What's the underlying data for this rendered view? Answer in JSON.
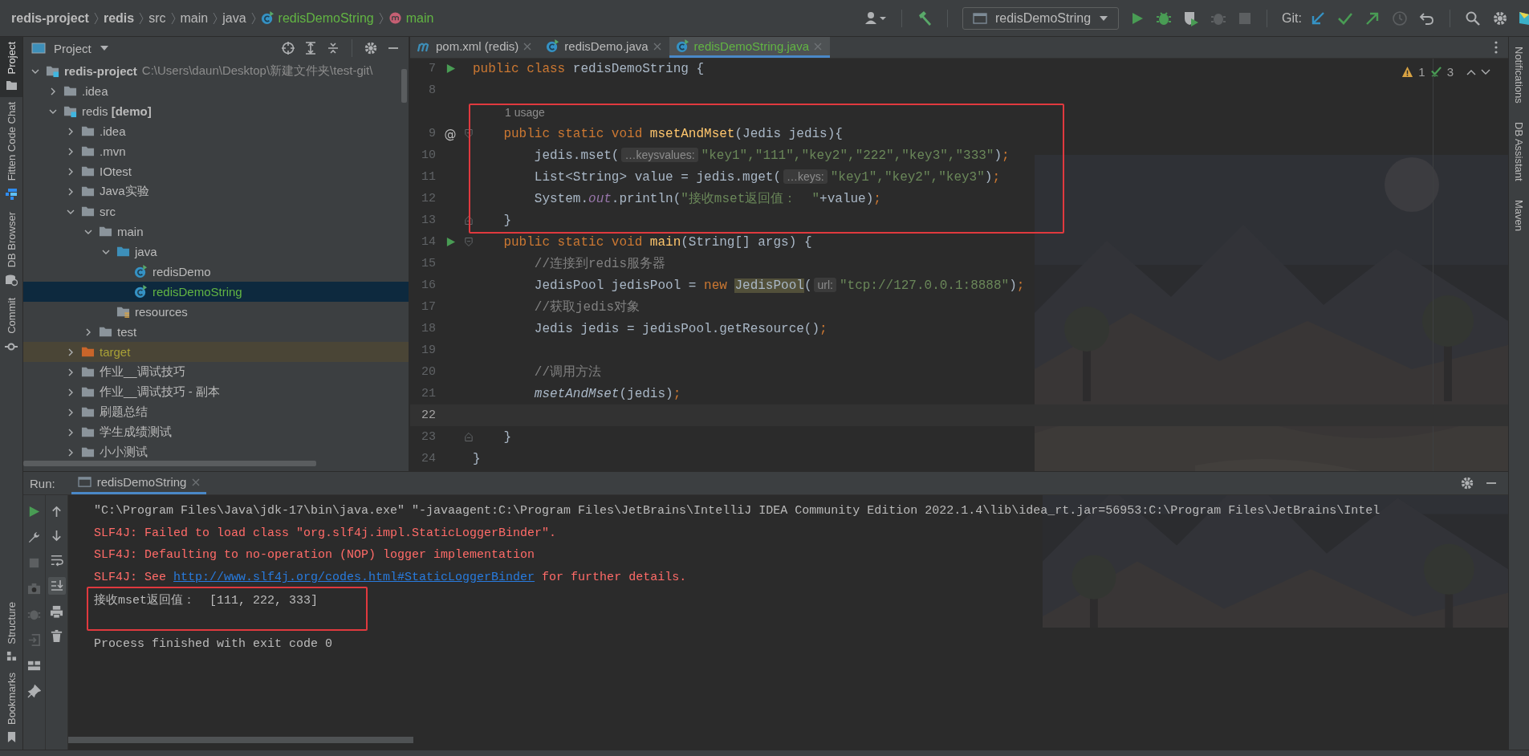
{
  "breadcrumbs": [
    {
      "text": "redis-project",
      "kind": "project",
      "added": false
    },
    {
      "text": "redis",
      "kind": "module",
      "added": false
    },
    {
      "text": "src",
      "kind": "folder",
      "added": false
    },
    {
      "text": "main",
      "kind": "folder",
      "added": false
    },
    {
      "text": "java",
      "kind": "folder",
      "added": false
    },
    {
      "text": "redisDemoString",
      "kind": "class",
      "added": true
    },
    {
      "text": "main",
      "kind": "method",
      "added": true
    }
  ],
  "toolbar": {
    "run_config": "redisDemoString",
    "git_label": "Git:"
  },
  "left_stripe": [
    {
      "label": "Project",
      "kind": "project",
      "selected": true
    },
    {
      "label": "Fitten Code Chat",
      "kind": "chat",
      "selected": false
    },
    {
      "label": "DB Browser",
      "kind": "db",
      "selected": false
    },
    {
      "label": "Commit",
      "kind": "commit",
      "selected": false
    }
  ],
  "left_stripe_bottom": [
    {
      "label": "Structure",
      "kind": "structure"
    },
    {
      "label": "Bookmarks",
      "kind": "bookmark"
    }
  ],
  "right_stripe": [
    {
      "label": "Notifications"
    },
    {
      "label": "DB Assistant"
    },
    {
      "label": "Maven"
    }
  ],
  "project": {
    "title": "Project",
    "tree": [
      {
        "label": "redis-project",
        "path": "C:\\Users\\daun\\Desktop\\新建文件夹\\test-git\\",
        "kind": "module",
        "expanded": true,
        "selected": false,
        "children": [
          {
            "label": ".idea",
            "kind": "folder",
            "expanded": false,
            "selected": false
          },
          {
            "label": "redis **[demo]**",
            "kind": "module",
            "expanded": true,
            "selected": false,
            "children": [
              {
                "label": ".idea",
                "kind": "folder",
                "expanded": false,
                "selected": false
              },
              {
                "label": ".mvn",
                "kind": "folder",
                "expanded": false,
                "selected": false
              },
              {
                "label": "IOtest",
                "kind": "folder",
                "expanded": false,
                "selected": false
              },
              {
                "label": "Java实验",
                "kind": "folder",
                "expanded": false,
                "selected": false
              },
              {
                "label": "src",
                "kind": "folder",
                "expanded": true,
                "selected": false,
                "children": [
                  {
                    "label": "main",
                    "kind": "folder",
                    "expanded": true,
                    "selected": false,
                    "children": [
                      {
                        "label": "java",
                        "kind": "source",
                        "expanded": true,
                        "selected": false,
                        "children": [
                          {
                            "label": "redisDemo",
                            "kind": "class",
                            "added": false,
                            "selected": false
                          },
                          {
                            "label": "redisDemoString",
                            "kind": "class",
                            "added": true,
                            "selected": true
                          }
                        ]
                      },
                      {
                        "label": "resources",
                        "kind": "resources",
                        "selected": false
                      }
                    ]
                  },
                  {
                    "label": "test",
                    "kind": "folder",
                    "expanded": false,
                    "selected": false
                  }
                ]
              },
              {
                "label": "target",
                "kind": "excluded",
                "expanded": false,
                "selected": false
              },
              {
                "label": "作业__调试技巧",
                "kind": "folder",
                "expanded": false,
                "selected": false
              },
              {
                "label": "作业__调试技巧 - 副本",
                "kind": "folder",
                "expanded": false,
                "selected": false
              },
              {
                "label": "刷题总结",
                "kind": "folder",
                "expanded": false,
                "selected": false
              },
              {
                "label": "学生成绩测试",
                "kind": "folder",
                "expanded": false,
                "selected": false
              },
              {
                "label": "小小测试",
                "kind": "folder",
                "expanded": false,
                "selected": false
              }
            ]
          }
        ]
      }
    ]
  },
  "editor": {
    "tabs": [
      {
        "label": "pom.xml (redis)",
        "kind": "maven",
        "added": false,
        "selected": false
      },
      {
        "label": "redisDemo.java",
        "kind": "class",
        "added": false,
        "selected": false
      },
      {
        "label": "redisDemoString.java",
        "kind": "class",
        "added": true,
        "selected": true
      }
    ],
    "warnings": "1",
    "weak_warnings": "3",
    "blocks": [
      {
        "boxed": false,
        "lines": [
          {
            "number": "7",
            "gutter": {
              "kind": "run"
            },
            "current": false,
            "tokens": [
              {
                "t": "public class ",
                "kind": "kw"
              },
              {
                "t": "redisDemoString {",
                "kind": "plain"
              }
            ]
          },
          {
            "number": "8",
            "current": false
          }
        ]
      },
      {
        "boxed": true,
        "lines": [
          {
            "kind": "usage",
            "text": "1 usage"
          },
          {
            "number": "9",
            "gutter_text": "@",
            "fold": {
              "kind": "start"
            },
            "current": false,
            "tokens": [
              {
                "t": "    public static void ",
                "kind": "kw"
              },
              {
                "t": "msetAndMset",
                "kind": "fn"
              },
              {
                "t": "(Jedis jedis){",
                "kind": "plain"
              }
            ]
          },
          {
            "number": "10",
            "current": false,
            "tokens": [
              {
                "t": "        jedis.mset(",
                "kind": "plain"
              },
              {
                "t": "…keysvalues:",
                "kind": "hint"
              },
              {
                "t": "\"key1\",\"111\",\"key2\",\"222\",\"key3\",\"333\"",
                "kind": "str"
              },
              {
                "t": ")",
                "kind": "plain"
              },
              {
                "t": ";",
                "kind": "semi"
              }
            ]
          },
          {
            "number": "11",
            "current": false,
            "tokens": [
              {
                "t": "        List<String> value = jedis.mget(",
                "kind": "plain"
              },
              {
                "t": "…keys:",
                "kind": "hint"
              },
              {
                "t": "\"key1\",\"key2\",\"key3\"",
                "kind": "str"
              },
              {
                "t": ")",
                "kind": "plain"
              },
              {
                "t": ";",
                "kind": "semi"
              }
            ]
          },
          {
            "number": "12",
            "current": false,
            "tokens": [
              {
                "t": "        System.",
                "kind": "plain"
              },
              {
                "t": "out",
                "kind": "field"
              },
              {
                "t": ".println(",
                "kind": "plain"
              },
              {
                "t": "\"接收mset返回值：  \"",
                "kind": "str"
              },
              {
                "t": "+value)",
                "kind": "plain"
              },
              {
                "t": ";",
                "kind": "semi"
              }
            ]
          },
          {
            "number": "13",
            "fold": {
              "kind": "end"
            },
            "current": false,
            "tokens": [
              {
                "t": "    }",
                "kind": "plain"
              }
            ]
          }
        ]
      },
      {
        "boxed": false,
        "lines": [
          {
            "number": "14",
            "gutter": {
              "kind": "run"
            },
            "fold": {
              "kind": "start"
            },
            "current": false,
            "tokens": [
              {
                "t": "    public static void ",
                "kind": "kw"
              },
              {
                "t": "main",
                "kind": "fn"
              },
              {
                "t": "(String[] args) {",
                "kind": "plain"
              }
            ]
          },
          {
            "number": "15",
            "current": false,
            "tokens": [
              {
                "t": "        //连接到redis服务器",
                "kind": "cmt"
              }
            ]
          },
          {
            "number": "16",
            "current": false,
            "tokens": [
              {
                "t": "        JedisPool jedisPool = ",
                "kind": "plain"
              },
              {
                "t": "new ",
                "kind": "kw"
              },
              {
                "t": "JedisPool",
                "kind": "mark"
              },
              {
                "t": "(",
                "kind": "plain"
              },
              {
                "t": "url:",
                "kind": "hint"
              },
              {
                "t": "\"tcp://127.0.0.1:8888\"",
                "kind": "str"
              },
              {
                "t": ")",
                "kind": "plain"
              },
              {
                "t": ";",
                "kind": "semi"
              }
            ]
          },
          {
            "number": "17",
            "current": false,
            "tokens": [
              {
                "t": "        //获取jedis对象",
                "kind": "cmt"
              }
            ]
          },
          {
            "number": "18",
            "current": false,
            "tokens": [
              {
                "t": "        Jedis jedis = jedisPool.getResource()",
                "kind": "plain"
              },
              {
                "t": ";",
                "kind": "semi"
              }
            ]
          },
          {
            "number": "19",
            "current": false
          },
          {
            "number": "20",
            "current": false,
            "tokens": [
              {
                "t": "        //调用方法",
                "kind": "cmt"
              }
            ]
          },
          {
            "number": "21",
            "current": false,
            "tokens": [
              {
                "t": "        msetAndMset",
                "kind": "ital"
              },
              {
                "t": "(jedis)",
                "kind": "plain"
              },
              {
                "t": ";",
                "kind": "semi"
              }
            ]
          },
          {
            "number": "22",
            "current": true
          },
          {
            "number": "23",
            "fold": {
              "kind": "end"
            },
            "current": false,
            "tokens": [
              {
                "t": "    }",
                "kind": "plain"
              }
            ]
          },
          {
            "number": "24",
            "current": false,
            "tokens": [
              {
                "t": "}",
                "kind": "plain"
              }
            ]
          }
        ]
      }
    ]
  },
  "run": {
    "label": "Run:",
    "tab": "redisDemoString",
    "blocks": [
      {
        "boxed": false,
        "lines": [
          {
            "segments": [
              {
                "text": "\"C:\\Program Files\\Java\\jdk-17\\bin\\java.exe\" \"-javaagent:C:\\Program Files\\JetBrains\\IntelliJ IDEA Community Edition 2022.1.4\\lib\\idea_rt.jar=56953:C:\\Program Files\\JetBrains\\Intel",
                "kind": "plain"
              }
            ]
          },
          {
            "segments": [
              {
                "text": "SLF4J: Failed to load class \"org.slf4j.impl.StaticLoggerBinder\".",
                "kind": "error"
              }
            ]
          },
          {
            "segments": [
              {
                "text": "SLF4J: Defaulting to no-operation (NOP) logger implementation",
                "kind": "error"
              }
            ]
          },
          {
            "segments": [
              {
                "text": "SLF4J: See ",
                "kind": "error"
              },
              {
                "text": "http://www.slf4j.org/codes.html#StaticLoggerBinder",
                "kind": "link"
              },
              {
                "text": " for further details.",
                "kind": "error"
              }
            ]
          }
        ]
      },
      {
        "boxed": true,
        "lines": [
          {
            "segments": [
              {
                "text": "接收mset返回值：  [111, 222, 333]",
                "kind": "plain"
              }
            ]
          }
        ]
      },
      {
        "boxed": false,
        "lines": [
          {
            "segments": [
              {
                "text": "Process finished with exit code 0",
                "kind": "plain"
              }
            ]
          }
        ]
      }
    ]
  }
}
